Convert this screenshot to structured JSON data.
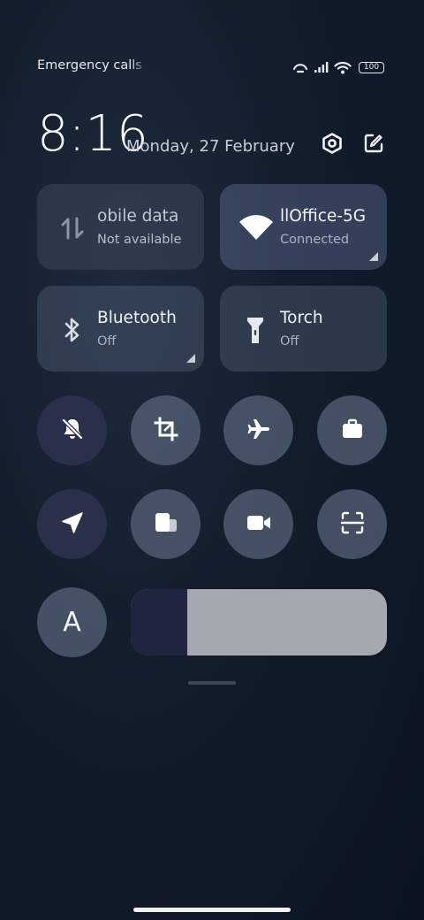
{
  "status_bar": {
    "carrier_text": "Emergency calls o",
    "battery_level": "100",
    "icons": [
      "hotspot-icon",
      "signal-icon",
      "wifi-icon",
      "battery-icon"
    ]
  },
  "header": {
    "time": "8:16",
    "date": "Monday, 27 February",
    "settings_icon": "settings-hexagon-icon",
    "edit_icon": "edit-icon"
  },
  "tiles": [
    {
      "id": "mobile-data",
      "title": "obile data",
      "subtitle": "Not available",
      "icon": "data-arrows-icon",
      "state": "unavailable"
    },
    {
      "id": "wifi",
      "title": "llOffice-5G",
      "subtitle": "Connected",
      "icon": "wifi-icon",
      "state": "on"
    },
    {
      "id": "bluetooth",
      "title": "Bluetooth",
      "subtitle": "Off",
      "icon": "bluetooth-icon",
      "state": "off"
    },
    {
      "id": "torch",
      "title": "Torch",
      "subtitle": "Off",
      "icon": "torch-icon",
      "state": "off"
    }
  ],
  "toggles": [
    {
      "id": "mute",
      "icon": "bell-off-icon",
      "active": true
    },
    {
      "id": "screenshot",
      "icon": "crop-icon",
      "active": false
    },
    {
      "id": "airplane",
      "icon": "airplane-icon",
      "active": false
    },
    {
      "id": "work",
      "icon": "briefcase-icon",
      "active": false
    },
    {
      "id": "location",
      "icon": "location-arrow-icon",
      "active": true
    },
    {
      "id": "cast",
      "icon": "cast-screens-icon",
      "active": false
    },
    {
      "id": "screen-record",
      "icon": "video-camera-icon",
      "active": false
    },
    {
      "id": "scanner",
      "icon": "scan-icon",
      "active": false
    }
  ],
  "auto_brightness": {
    "label": "A"
  },
  "brightness": {
    "level": 0.22
  },
  "colors": {
    "background": "#121c2b",
    "active_round": "#2c324e",
    "inactive_round": "#6e7c91",
    "slider_fill": "#1f2540",
    "slider_track": "#a4a9b1"
  }
}
